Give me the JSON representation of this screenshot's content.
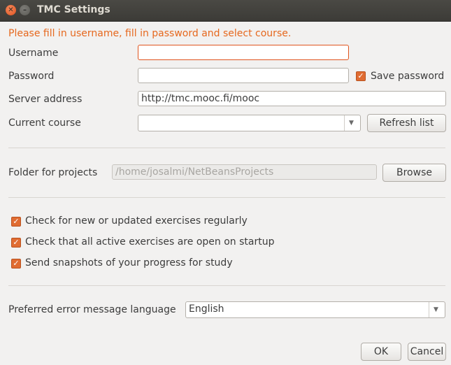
{
  "window": {
    "title": "TMC Settings"
  },
  "warning": "Please fill in username, fill in password and select course.",
  "form": {
    "username_label": "Username",
    "username_value": "",
    "password_label": "Password",
    "password_value": "",
    "save_password_label": "Save password",
    "save_password_checked": true,
    "server_label": "Server address",
    "server_value": "http://tmc.mooc.fi/mooc",
    "course_label": "Current course",
    "course_value": "",
    "refresh_label": "Refresh list",
    "folder_label": "Folder for projects",
    "folder_value": "/home/josalmi/NetBeansProjects",
    "browse_label": "Browse"
  },
  "options": [
    {
      "label": "Check for new or updated exercises regularly",
      "checked": true
    },
    {
      "label": "Check that all active exercises are open on startup",
      "checked": true
    },
    {
      "label": "Send snapshots of your progress for study",
      "checked": true
    }
  ],
  "language": {
    "label": "Preferred error message language",
    "value": "English"
  },
  "footer": {
    "ok_label": "OK",
    "cancel_label": "Cancel"
  },
  "colors": {
    "accent": "#e06c32",
    "warning": "#e6681e",
    "titlebar": "#3c3b37"
  }
}
